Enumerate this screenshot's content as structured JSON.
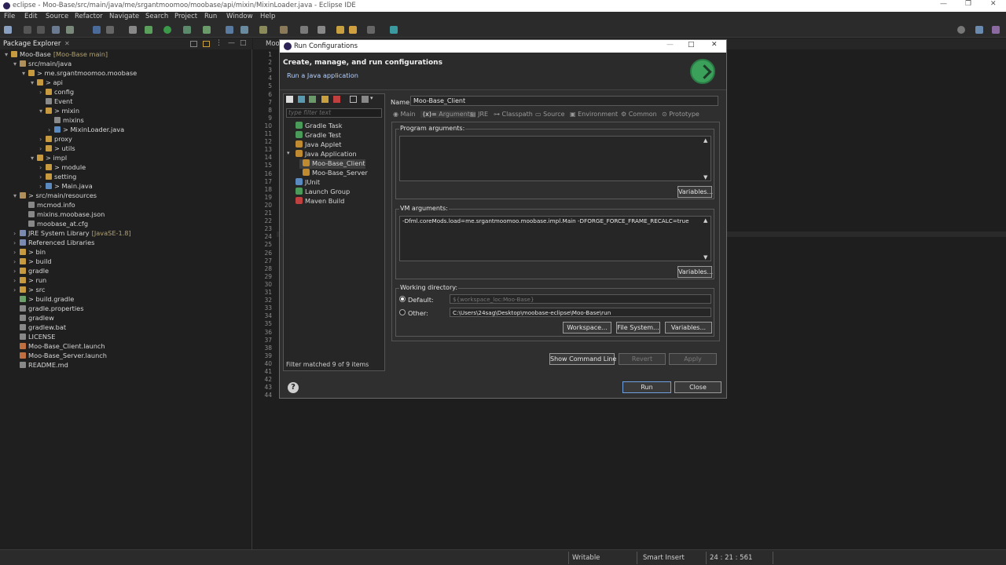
{
  "window": {
    "title": "eclipse - Moo-Base/src/main/java/me/srgantmoomoo/moobase/api/mixin/MixinLoader.java - Eclipse IDE"
  },
  "menu": [
    "File",
    "Edit",
    "Source",
    "Refactor",
    "Navigate",
    "Search",
    "Project",
    "Run",
    "Window",
    "Help"
  ],
  "package_explorer": {
    "tab": "Package Explorer",
    "tree": [
      {
        "label": "Moo-Base",
        "suffix": "[Moo-Base main]",
        "indent": 0,
        "arrow": "▾"
      },
      {
        "label": "src/main/java",
        "indent": 1,
        "arrow": "▾"
      },
      {
        "label": "> me.srgantmoomoo.moobase",
        "indent": 2,
        "arrow": "▾"
      },
      {
        "label": "> api",
        "indent": 3,
        "arrow": "▾"
      },
      {
        "label": "config",
        "indent": 4,
        "arrow": "›"
      },
      {
        "label": "Event",
        "indent": 4,
        "arrow": ""
      },
      {
        "label": "> mixin",
        "indent": 4,
        "arrow": "▾"
      },
      {
        "label": "mixins",
        "indent": 5,
        "arrow": ""
      },
      {
        "label": "> MixinLoader.java",
        "indent": 5,
        "arrow": "›"
      },
      {
        "label": "proxy",
        "indent": 4,
        "arrow": "›"
      },
      {
        "label": "> utils",
        "indent": 4,
        "arrow": "›"
      },
      {
        "label": "> impl",
        "indent": 3,
        "arrow": "▾"
      },
      {
        "label": "> module",
        "indent": 4,
        "arrow": "›"
      },
      {
        "label": "setting",
        "indent": 4,
        "arrow": "›"
      },
      {
        "label": "> Main.java",
        "indent": 4,
        "arrow": "›"
      },
      {
        "label": "> src/main/resources",
        "indent": 1,
        "arrow": "▾"
      },
      {
        "label": "mcmod.info",
        "indent": 2,
        "arrow": ""
      },
      {
        "label": "mixins.moobase.json",
        "indent": 2,
        "arrow": ""
      },
      {
        "label": "moobase_at.cfg",
        "indent": 2,
        "arrow": ""
      },
      {
        "label": "JRE System Library",
        "suffix": "[JavaSE-1.8]",
        "indent": 1,
        "arrow": "›"
      },
      {
        "label": "Referenced Libraries",
        "indent": 1,
        "arrow": "›"
      },
      {
        "label": "> bin",
        "indent": 1,
        "arrow": "›"
      },
      {
        "label": "> build",
        "indent": 1,
        "arrow": "›"
      },
      {
        "label": "gradle",
        "indent": 1,
        "arrow": "›"
      },
      {
        "label": "> run",
        "indent": 1,
        "arrow": "›"
      },
      {
        "label": "> src",
        "indent": 1,
        "arrow": "›"
      },
      {
        "label": "> build.gradle",
        "indent": 1,
        "arrow": ""
      },
      {
        "label": "gradle.properties",
        "indent": 1,
        "arrow": ""
      },
      {
        "label": "gradlew",
        "indent": 1,
        "arrow": ""
      },
      {
        "label": "gradlew.bat",
        "indent": 1,
        "arrow": ""
      },
      {
        "label": "LICENSE",
        "indent": 1,
        "arrow": ""
      },
      {
        "label": "Moo-Base_Client.launch",
        "indent": 1,
        "arrow": ""
      },
      {
        "label": "Moo-Base_Server.launch",
        "indent": 1,
        "arrow": ""
      },
      {
        "label": "README.md",
        "indent": 1,
        "arrow": ""
      }
    ]
  },
  "editor": {
    "tab": "Moo",
    "line_numbers": [
      "1",
      "2",
      "3",
      "4",
      "5",
      "6",
      "7",
      "8",
      "9",
      "10",
      "11",
      "12",
      "13",
      "14",
      "15",
      "16",
      "17",
      "18",
      "19",
      "20",
      "21",
      "22",
      "23",
      "24",
      "25",
      "26",
      "27",
      "28",
      "29",
      "30",
      "31",
      "32",
      "33",
      "34",
      "35",
      "36",
      "37",
      "38",
      "39",
      "40",
      "41",
      "42",
      "43",
      "44"
    ]
  },
  "dialog": {
    "title": "Run Configurations",
    "heading": "Create, manage, and run configurations",
    "subheading": "Run a Java application",
    "filter_placeholder": "type filter text",
    "configs": [
      {
        "label": "Gradle Task",
        "indent": 1,
        "color": "#4a9a5a"
      },
      {
        "label": "Gradle Test",
        "indent": 1,
        "color": "#4a9a5a"
      },
      {
        "label": "Java Applet",
        "indent": 1,
        "color": "#c08a30"
      },
      {
        "label": "Java Application",
        "indent": 1,
        "color": "#c08a30",
        "arrow": "▾"
      },
      {
        "label": "Moo-Base_Client",
        "indent": 2,
        "color": "#c08a30",
        "selected": true
      },
      {
        "label": "Moo-Base_Server",
        "indent": 2,
        "color": "#c08a30"
      },
      {
        "label": "JUnit",
        "indent": 1,
        "color": "#5a8ac0"
      },
      {
        "label": "Launch Group",
        "indent": 1,
        "color": "#4a9a5a"
      },
      {
        "label": "Maven Build",
        "indent": 1,
        "color": "#c04040"
      }
    ],
    "filter_message": "Filter matched 9 of 9 items",
    "name_label": "Name:",
    "name_value": "Moo-Base_Client",
    "tabs": [
      "Main",
      "Arguments",
      "JRE",
      "Classpath",
      "Source",
      "Environment",
      "Common",
      "Prototype"
    ],
    "active_tab": "Arguments",
    "program_args_label": "Program arguments:",
    "program_args_value": "",
    "variables_label": "Variables...",
    "vm_args_label": "VM arguments:",
    "vm_args_value": "-Dfml.coreMods.load=me.srgantmoomoo.moobase.impl.Main -DFORGE_FORCE_FRAME_RECALC=true",
    "workdir_label": "Working directory:",
    "default_label": "Default:",
    "default_value": "${workspace_loc:Moo-Base}",
    "other_label": "Other:",
    "other_value": "C:\\Users\\24sag\\Desktop\\moobase-eclipse\\Moo-Base\\run",
    "workspace_btn": "Workspace...",
    "filesystem_btn": "File System...",
    "show_cmd_btn": "Show Command Line",
    "revert_btn": "Revert",
    "apply_btn": "Apply",
    "run_btn": "Run",
    "close_btn": "Close"
  },
  "status": {
    "writable": "Writable",
    "insert": "Smart Insert",
    "position": "24 : 21 : 561"
  }
}
